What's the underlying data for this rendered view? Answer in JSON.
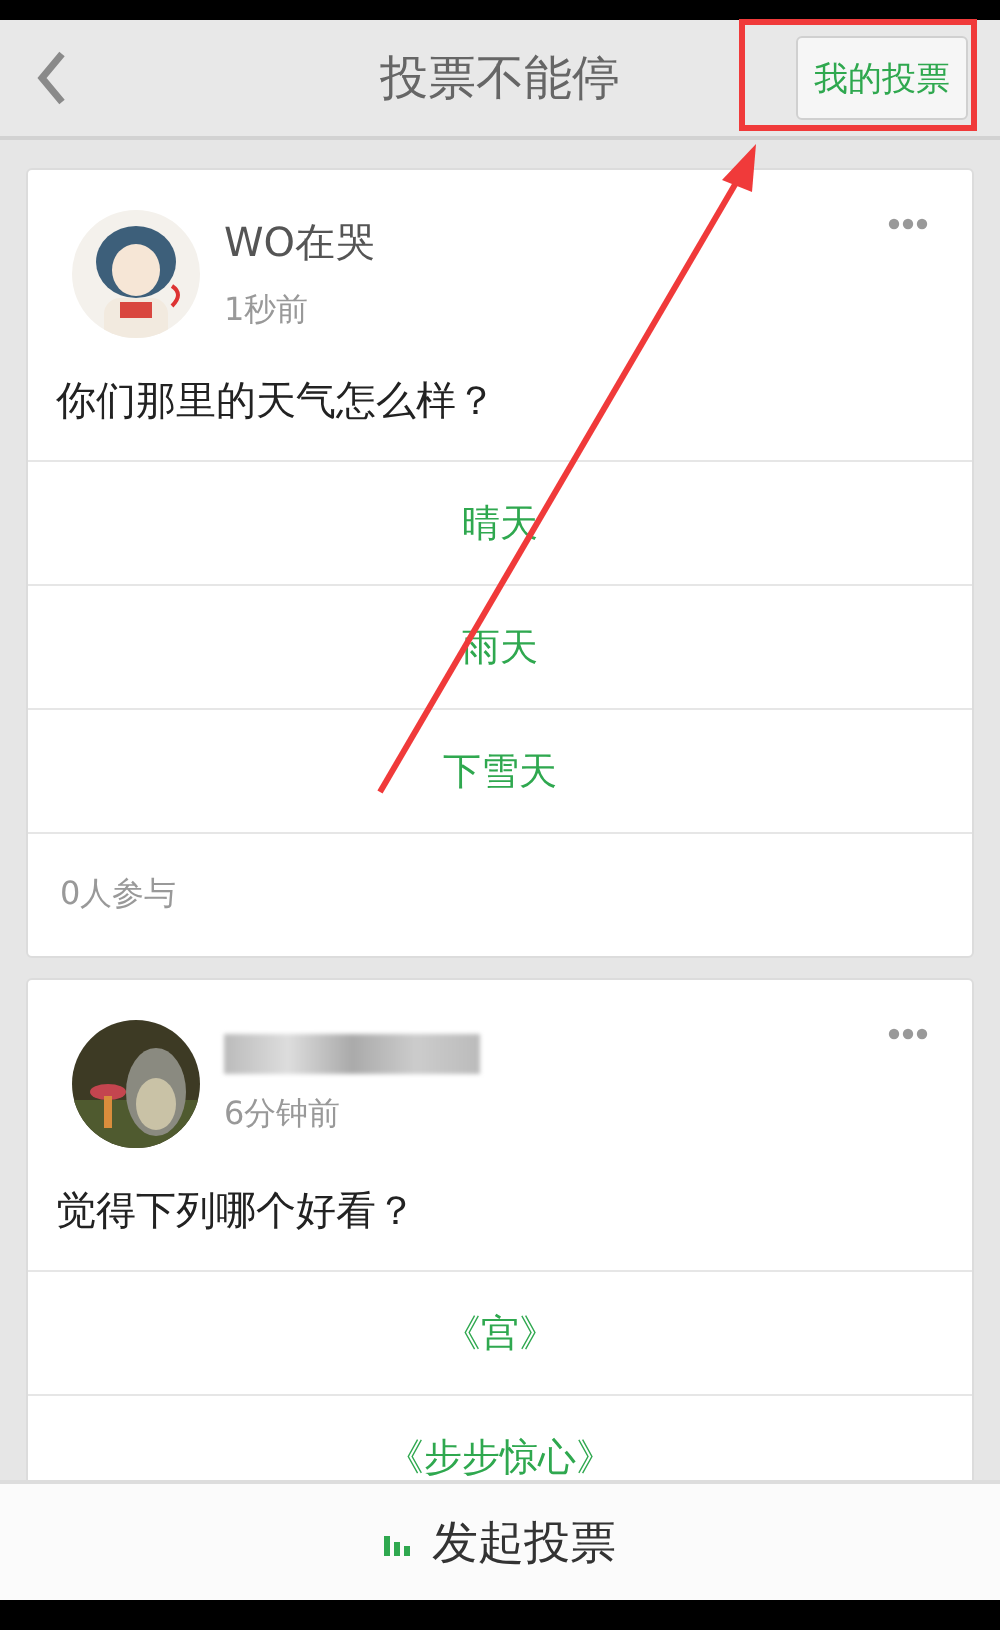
{
  "header": {
    "title": "投票不能停",
    "action_button": "我的投票"
  },
  "polls": [
    {
      "author": "WO在哭",
      "author_blurred": false,
      "time": "1秒前",
      "question": "你们那里的天气怎么样？",
      "options": [
        "晴天",
        "雨天",
        "下雪天"
      ],
      "participants": "0人参与"
    },
    {
      "author_blurred": true,
      "time": "6分钟前",
      "question": "觉得下列哪个好看？",
      "options": [
        "《宫》",
        "《步步惊心》"
      ]
    }
  ],
  "footer": {
    "button": "发起投票"
  }
}
